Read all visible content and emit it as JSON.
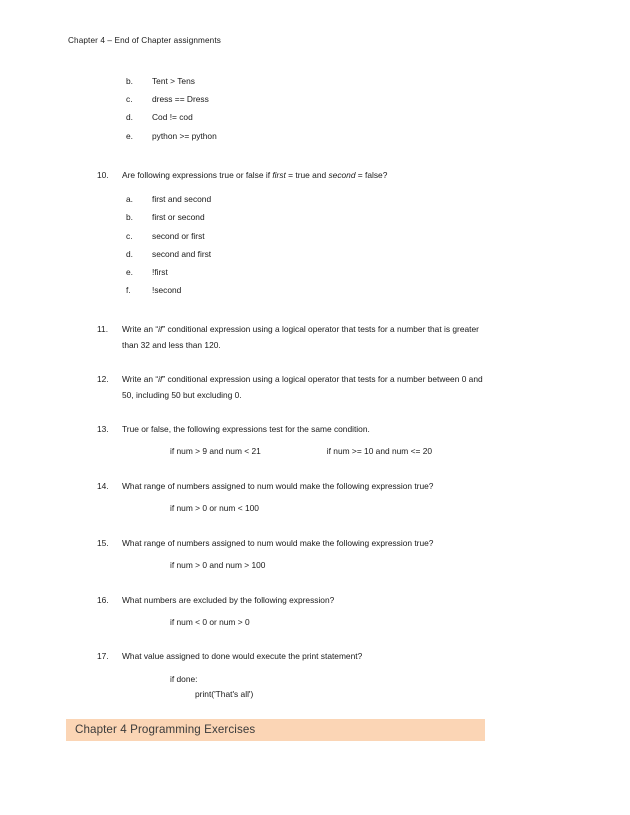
{
  "document": {
    "running_header": "Chapter 4 – End of Chapter assignments"
  },
  "continued_list": {
    "items": [
      {
        "marker": "b.",
        "text": "Tent > Tens"
      },
      {
        "marker": "c.",
        "text": "dress == Dress"
      },
      {
        "marker": "d.",
        "text": "Cod != cod"
      },
      {
        "marker": "e.",
        "text": "python >= python"
      }
    ]
  },
  "questions": [
    {
      "number": "10.",
      "text_before_first": "Are following expressions true or false if ",
      "italic_first": "first",
      "text_mid": " = true and ",
      "italic_second": "second",
      "text_after": " = false?",
      "subitems": [
        {
          "marker": "a.",
          "text": "first and second"
        },
        {
          "marker": "b.",
          "text": "first or second"
        },
        {
          "marker": "c.",
          "text": "second or first"
        },
        {
          "marker": "d.",
          "text": "second and first"
        },
        {
          "marker": "e.",
          "text": "!first"
        },
        {
          "marker": "f.",
          "text": "!second"
        }
      ]
    },
    {
      "number": "11.",
      "text_a": "Write an “",
      "italic_if": "if",
      "text_b": "” conditional expression using a logical operator that tests for a number that is greater than 32 and less than 120."
    },
    {
      "number": "12.",
      "text_a": "Write an “",
      "italic_if": "if",
      "text_b": "” conditional expression using a logical operator that tests for a number between 0 and 50, including 50 but excluding 0."
    },
    {
      "number": "13.",
      "text": "True or false, the following expressions test for the same condition.",
      "code_left": "if num > 9 and num < 21",
      "code_right": "if num >= 10 and num <= 20"
    },
    {
      "number": "14.",
      "text": "What range of numbers assigned to num would make the following expression true?",
      "code": "if num > 0 or num < 100"
    },
    {
      "number": "15.",
      "text": "What range of numbers assigned to num would make the following expression true?",
      "code": "if num > 0 and num > 100"
    },
    {
      "number": "16.",
      "text": "What numbers are excluded by the following expression?",
      "code": "if num < 0 or num > 0"
    },
    {
      "number": "17.",
      "text": "What value assigned to done would execute the print statement?",
      "code_1": "if done:",
      "code_2": "print('That's all')"
    }
  ],
  "section_heading": {
    "title": "Chapter 4 Programming Exercises",
    "background_color": "#fbd5b5"
  }
}
